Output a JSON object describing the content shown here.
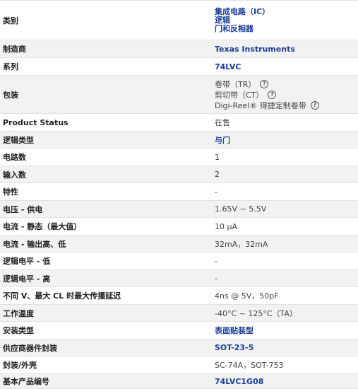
{
  "rows": [
    {
      "label": "类别",
      "lines": [
        "集成电路（IC）",
        "逻辑",
        "门和反相器"
      ],
      "link": true
    },
    {
      "label": "制造商",
      "value": "Texas Instruments",
      "link": true
    },
    {
      "label": "系列",
      "value": "74LVC",
      "link": true
    },
    {
      "label": "包装",
      "packaging": [
        "卷带（TR）",
        "剪切带（CT）",
        "Digi-Reel® 得捷定制卷带"
      ]
    },
    {
      "label": "Product Status",
      "value": "在售"
    },
    {
      "label": "逻辑类型",
      "value": "与门",
      "link": true
    },
    {
      "label": "电路数",
      "value": "1"
    },
    {
      "label": "输入数",
      "value": "2"
    },
    {
      "label": "特性",
      "value": "-"
    },
    {
      "label": "电压 - 供电",
      "value": "1.65V ~ 5.5V"
    },
    {
      "label": "电流 - 静态（最大值）",
      "value": "10 µA"
    },
    {
      "label": "电流 - 输出高、低",
      "value": "32mA，32mA"
    },
    {
      "label": "逻辑电平 - 低",
      "value": "-"
    },
    {
      "label": "逻辑电平 - 高",
      "value": "-"
    },
    {
      "label": "不同 V、最大 CL 时最大传播延迟",
      "value": "4ns @ 5V，50pF"
    },
    {
      "label": "工作温度",
      "value": "-40°C ~ 125°C（TA）"
    },
    {
      "label": "安装类型",
      "value": "表面贴装型",
      "link": true
    },
    {
      "label": "供应商器件封装",
      "value": "SOT-23-5",
      "link": true
    },
    {
      "label": "封装/外壳",
      "value": "SC-74A，SOT-753"
    },
    {
      "label": "基本产品编号",
      "value": "74LVC1G08",
      "link": true
    }
  ],
  "help_icon_glyph": "?"
}
